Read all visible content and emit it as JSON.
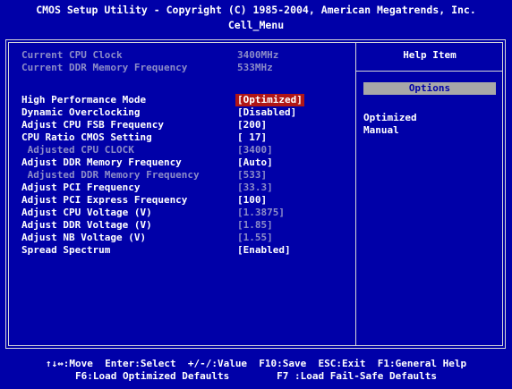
{
  "header": {
    "title": "CMOS Setup Utility - Copyright (C) 1985-2004, American Megatrends, Inc.",
    "menu_name": "Cell_Menu"
  },
  "info": [
    {
      "label": "Current CPU Clock",
      "value": "3400MHz"
    },
    {
      "label": "Current DDR Memory Frequency",
      "value": "533MHz"
    }
  ],
  "settings": [
    {
      "label": "High Performance Mode",
      "value": "[Optimized]"
    },
    {
      "label": "Dynamic Overclocking",
      "value": "[Disabled]"
    },
    {
      "label": "Adjust CPU FSB Frequency",
      "value": "[200]"
    },
    {
      "label": "CPU Ratio CMOS Setting",
      "value": "[ 17]"
    },
    {
      "label": " Adjusted CPU CLOCK",
      "value": "[3400]"
    },
    {
      "label": "Adjust DDR Memory Frequency",
      "value": "[Auto]"
    },
    {
      "label": " Adjusted DDR Memory Frequency",
      "value": "[533]"
    },
    {
      "label": "Adjust PCI Frequency",
      "value": "[33.3]"
    },
    {
      "label": "Adjust PCI Express Frequency",
      "value": "[100]"
    },
    {
      "label": "Adjust CPU Voltage (V)",
      "value": "[1.3875]"
    },
    {
      "label": "Adjust DDR Voltage (V)",
      "value": "[1.85]"
    },
    {
      "label": "Adjust NB Voltage (V)",
      "value": "[1.55]"
    },
    {
      "label": "Spread Spectrum",
      "value": "[Enabled]"
    }
  ],
  "help": {
    "title": "Help Item",
    "options_label": "Options",
    "options": [
      "Optimized",
      "Manual"
    ]
  },
  "footer": {
    "line1": "↑↓↔:Move  Enter:Select  +/-/:Value  F10:Save  ESC:Exit  F1:General Help",
    "line2": "F6:Load Optimized Defaults        F7 :Load Fail-Safe Defaults"
  },
  "colors": {
    "background": "#0000a8",
    "selected": "#b01616",
    "dim_text": "#8c8cc8",
    "options_bar": "#a8a8a8"
  }
}
